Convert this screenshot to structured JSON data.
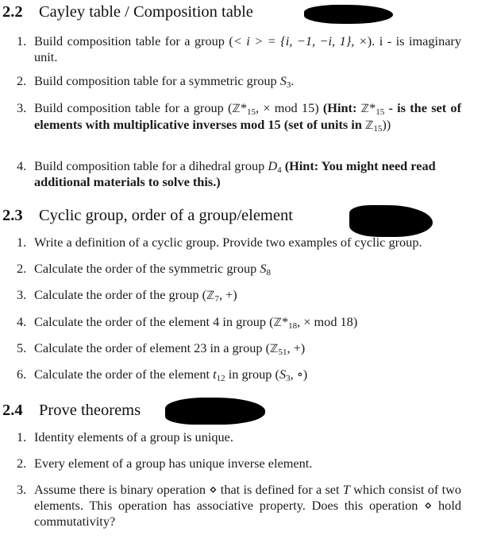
{
  "sections": [
    {
      "number": "2.2",
      "title": "Cayley table / Composition table",
      "items": [
        {
          "num": "1.",
          "text_pre": "Build composition table for a group (",
          "math": "< i > = {i, −1, −i, 1}, ×",
          "text_post": ").  i - is imaginary unit."
        },
        {
          "num": "2.",
          "text_pre": "Build composition table for a symmetric group ",
          "math_sym": "S",
          "math_sub": "3",
          "text_post": "."
        },
        {
          "num": "3.",
          "text_pre": "Build composition table for a group (",
          "set": "ℤ",
          "star": "*",
          "sub": "15",
          "op": ", × mod 15) ",
          "hint_label": "(Hint: ",
          "hint_set": "ℤ",
          "hint_star": "*",
          "hint_sub": "15",
          "hint_text": " - is the set of elements with multiplicative inverses mod 15 (set of units in ",
          "hint_set2": "ℤ",
          "hint_sub2": "15",
          "hint_close": "))"
        },
        {
          "num": "4.",
          "text_pre": "Build composition table for a dihedral group ",
          "math_sym": "D",
          "math_sub": "4",
          "hint": " (Hint: You might need read additional materials to solve this.)"
        }
      ]
    },
    {
      "number": "2.3",
      "title": "Cyclic group, order of a group/element",
      "items": [
        {
          "num": "1.",
          "text": "Write a definition of a cyclic group. Provide two examples of cyclic group."
        },
        {
          "num": "2.",
          "text_pre": "Calculate the order of the symmetric group ",
          "math_sym": "S",
          "math_sub": "8"
        },
        {
          "num": "3.",
          "text_pre": "Calculate the order of the group (",
          "set": "ℤ",
          "sub": "7",
          "text_post": ", +)"
        },
        {
          "num": "4.",
          "text_pre": "Calculate the order of the element 4 in group (",
          "set": "ℤ",
          "star": "*",
          "sub": "18",
          "text_post": ", × mod 18)"
        },
        {
          "num": "5.",
          "text_pre": "Calculate the order of element 23 in a group (",
          "set": "ℤ",
          "sub": "51",
          "text_post": ", +)"
        },
        {
          "num": "6.",
          "text_pre": "Calculate the order of the element ",
          "math_sym": "t",
          "math_sub": "12",
          "text_mid": " in group (",
          "group_sym": "S",
          "group_sub": "3",
          "text_post": ", ∘)"
        }
      ]
    },
    {
      "number": "2.4",
      "title": "Prove theorems",
      "items": [
        {
          "num": "1.",
          "text": "Identity elements of a group is unique."
        },
        {
          "num": "2.",
          "text": "Every element of a group has unique inverse element."
        },
        {
          "num": "3.",
          "text_pre": "Assume there is binary operation ",
          "op": "⋄",
          "text_mid": " that is defined for a set ",
          "set_sym": "T",
          "text_mid2": " which consist of two elements.  This operation has associative property.  Does this operation ",
          "op2": "⋄",
          "text_post": " hold commutativity?"
        }
      ]
    }
  ],
  "redactions": [
    "redaction-1",
    "redaction-2",
    "redaction-3"
  ]
}
